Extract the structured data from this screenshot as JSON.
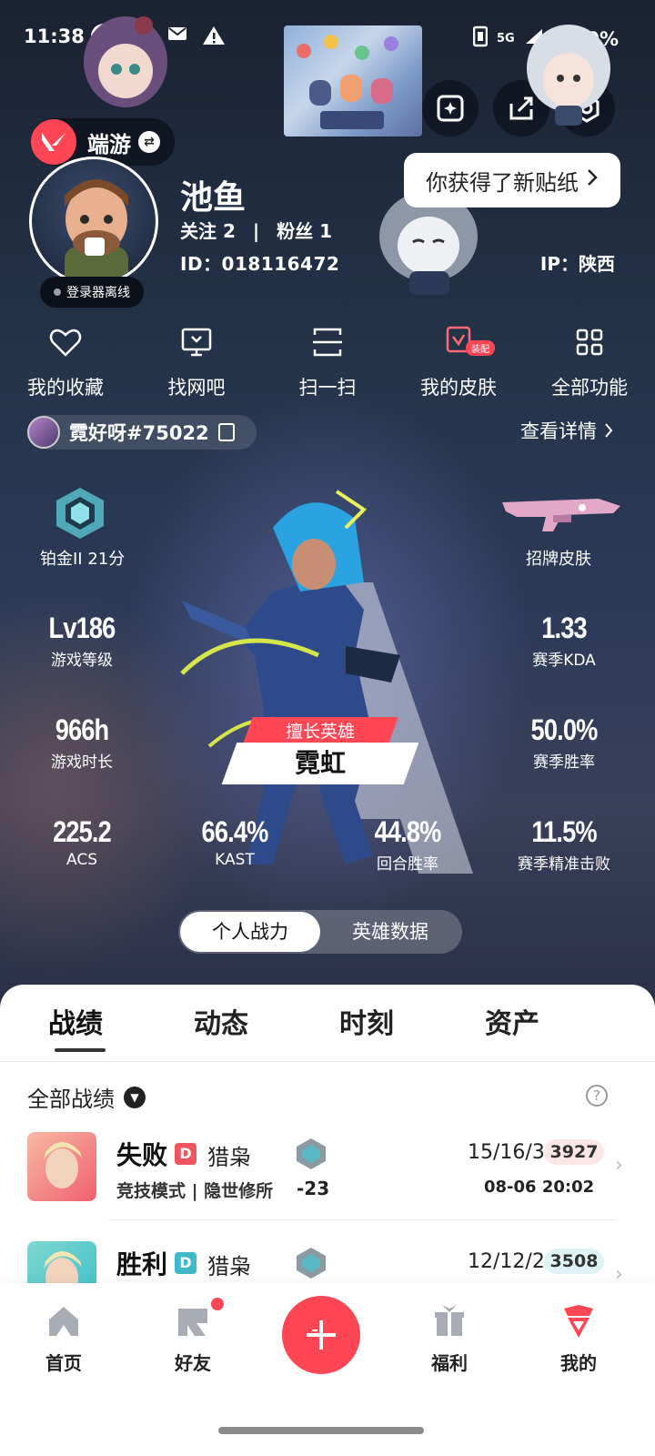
{
  "status_bar": {
    "time": "11:38",
    "network": "5G",
    "battery": "60%"
  },
  "profile": {
    "mode_label": "端游",
    "login_status": "登录器离线",
    "name": "池鱼",
    "follow_label": "关注",
    "follow_count": "2",
    "fans_label": "粉丝",
    "fans_count": "1",
    "id_text": "ID：018116472",
    "ip_text": "IP：陕西",
    "sticker_tip": "你获得了新贴纸"
  },
  "shortcuts": [
    {
      "label": "我的收藏",
      "icon": "heart-icon"
    },
    {
      "label": "找网吧",
      "icon": "monitor-icon"
    },
    {
      "label": "扫一扫",
      "icon": "scan-icon"
    },
    {
      "label": "我的皮肤",
      "icon": "skin-icon",
      "badge": "装配"
    },
    {
      "label": "全部功能",
      "icon": "grid-icon"
    }
  ],
  "account": {
    "riot_id": "霓好呀#75022",
    "details_label": "查看详情"
  },
  "stats": {
    "rank_label": "铂金II 21分",
    "showcase_skin_label": "招牌皮肤",
    "level_value": "Lv186",
    "level_label": "游戏等级",
    "kda_value": "1.33",
    "kda_label": "赛季KDA",
    "hours_value": "966h",
    "hours_label": "游戏时长",
    "winrate_value": "50.0%",
    "winrate_label": "赛季胜率",
    "acs_value": "225.2",
    "acs_label": "ACS",
    "kast_value": "66.4%",
    "kast_label": "KAST",
    "round_win_value": "44.8%",
    "round_win_label": "回合胜率",
    "precise_kill_value": "11.5%",
    "precise_kill_label": "赛季精准击败",
    "best_agent_tag": "擅长英雄",
    "best_agent_name": "霓虹"
  },
  "segment": {
    "left": "个人战力",
    "right": "英雄数据"
  },
  "tabs": [
    "战绩",
    "动态",
    "时刻",
    "资产"
  ],
  "filter": {
    "label": "全部战绩"
  },
  "matches": [
    {
      "result": "失败",
      "badge": "D",
      "badge_color": "#f05560",
      "agent": "猎枭",
      "mode": "竞技模式 | 隐世修所",
      "delta": "-23",
      "kda": "15/16/3",
      "score": "3927",
      "score_bg": "#fde6e8",
      "date": "08-06 20:02",
      "thumb_color": "#f06070"
    },
    {
      "result": "胜利",
      "badge": "D",
      "badge_color": "#3fb8c8",
      "agent": "猎枭",
      "kda": "12/12/2",
      "score": "3508",
      "score_bg": "#dff3f4",
      "thumb_color": "#3cc0c8"
    }
  ],
  "bottom_nav": [
    {
      "label": "首页",
      "icon": "home-icon"
    },
    {
      "label": "好友",
      "icon": "friends-icon"
    },
    {
      "label": "福利",
      "icon": "gift-icon"
    },
    {
      "label": "我的",
      "icon": "mine-icon"
    }
  ],
  "colors": {
    "accent": "#ff4655",
    "hero_bg": "#243349"
  }
}
